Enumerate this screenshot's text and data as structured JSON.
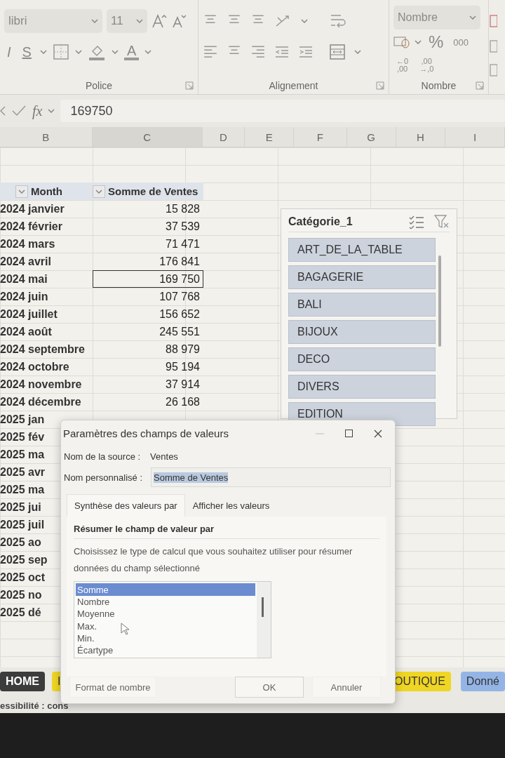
{
  "ribbon": {
    "font_name": "libri",
    "font_size": "11",
    "italic_label": "I",
    "underline_label": "S",
    "font_color_label": "A",
    "groups": [
      {
        "label": "Police"
      },
      {
        "label": "Alignement"
      },
      {
        "label": "Nombre"
      }
    ],
    "number_format": "Nombre",
    "percent_label": "%",
    "thousands_label": "000",
    "increase_decimal": [
      "←0",
      ",00"
    ],
    "decrease_decimal": [
      ",00",
      "→,0"
    ]
  },
  "formula_bar": {
    "function_label": "fx",
    "value": "169750"
  },
  "columns": [
    "B",
    "C",
    "D",
    "E",
    "F",
    "G",
    "H",
    "I"
  ],
  "pivot": {
    "headers": [
      "Month",
      "Somme de Ventes"
    ],
    "rows": [
      {
        "label": "2024 janvier",
        "value": "15 828",
        "selected": false
      },
      {
        "label": "2024 février",
        "value": "37 539",
        "selected": false
      },
      {
        "label": "2024 mars",
        "value": "71 471",
        "selected": false
      },
      {
        "label": "2024 avril",
        "value": "176 841",
        "selected": false
      },
      {
        "label": "2024 mai",
        "value": "169 750",
        "selected": true
      },
      {
        "label": "2024 juin",
        "value": "107 768",
        "selected": false
      },
      {
        "label": "2024 juillet",
        "value": "156 652",
        "selected": false
      },
      {
        "label": "2024 août",
        "value": "245 551",
        "selected": false
      },
      {
        "label": "2024 septembre",
        "value": "88 979",
        "selected": false
      },
      {
        "label": "2024 octobre",
        "value": "95 194",
        "selected": false
      },
      {
        "label": "2024 novembre",
        "value": "37 914",
        "selected": false
      },
      {
        "label": "2024 décembre",
        "value": "26 168",
        "selected": false
      },
      {
        "label": "2025 jan"
      },
      {
        "label": "2025 fév"
      },
      {
        "label": "2025 ma"
      },
      {
        "label": "2025 avr"
      },
      {
        "label": "2025 ma"
      },
      {
        "label": "2025 jui"
      },
      {
        "label": "2025 juil"
      },
      {
        "label": "2025 ao"
      },
      {
        "label": "2025 sep"
      },
      {
        "label": "2025 oct"
      },
      {
        "label": "2025 no"
      },
      {
        "label": "2025 dé"
      }
    ]
  },
  "slicer": {
    "title": "Catégorie_1",
    "items": [
      {
        "label": "ART_DE_LA_TABLE",
        "selected": true
      },
      {
        "label": "BAGAGERIE",
        "selected": true
      },
      {
        "label": "BALI",
        "selected": true
      },
      {
        "label": "BIJOUX",
        "selected": true
      },
      {
        "label": "DECO",
        "selected": true
      },
      {
        "label": "DIVERS",
        "selected": true
      },
      {
        "label": "EDITION",
        "selected": true
      }
    ]
  },
  "dialog": {
    "title": "Paramètres des champs de valeurs",
    "source_label": "Nom de la source :",
    "source_value": "Ventes",
    "custom_label": "Nom personnalisé :",
    "custom_value": "Somme de Ventes",
    "tabs": [
      {
        "label": "Synthèse des valeurs par",
        "selected": true
      },
      {
        "label": "Afficher les valeurs",
        "selected": false
      }
    ],
    "section_title": "Résumer le champ de valeur par",
    "description": "Choisissez le type de calcul que vous souhaitez utiliser pour résumer données du champ sélectionné",
    "options": [
      {
        "label": "Somme",
        "selected": true
      },
      {
        "label": "Nombre",
        "selected": false
      },
      {
        "label": "Moyenne",
        "selected": false
      },
      {
        "label": "Max.",
        "selected": false
      },
      {
        "label": "Min.",
        "selected": false
      },
      {
        "label": "Écartype",
        "selected": false
      }
    ],
    "buttons": [
      "Format de nombre",
      "OK",
      "Annuler"
    ]
  },
  "sheet_tabs": [
    {
      "label": "HOME",
      "color": "#3c3c3c"
    },
    {
      "label": "I",
      "color": "#f0d624"
    }
  ],
  "sheet_tabs_right": [
    {
      "label": "OUTIQUE",
      "color": "#f0d624"
    },
    {
      "label": "Donné",
      "color": "#94b4e6"
    }
  ],
  "status_bar": {
    "text": "essibilité : cons"
  }
}
